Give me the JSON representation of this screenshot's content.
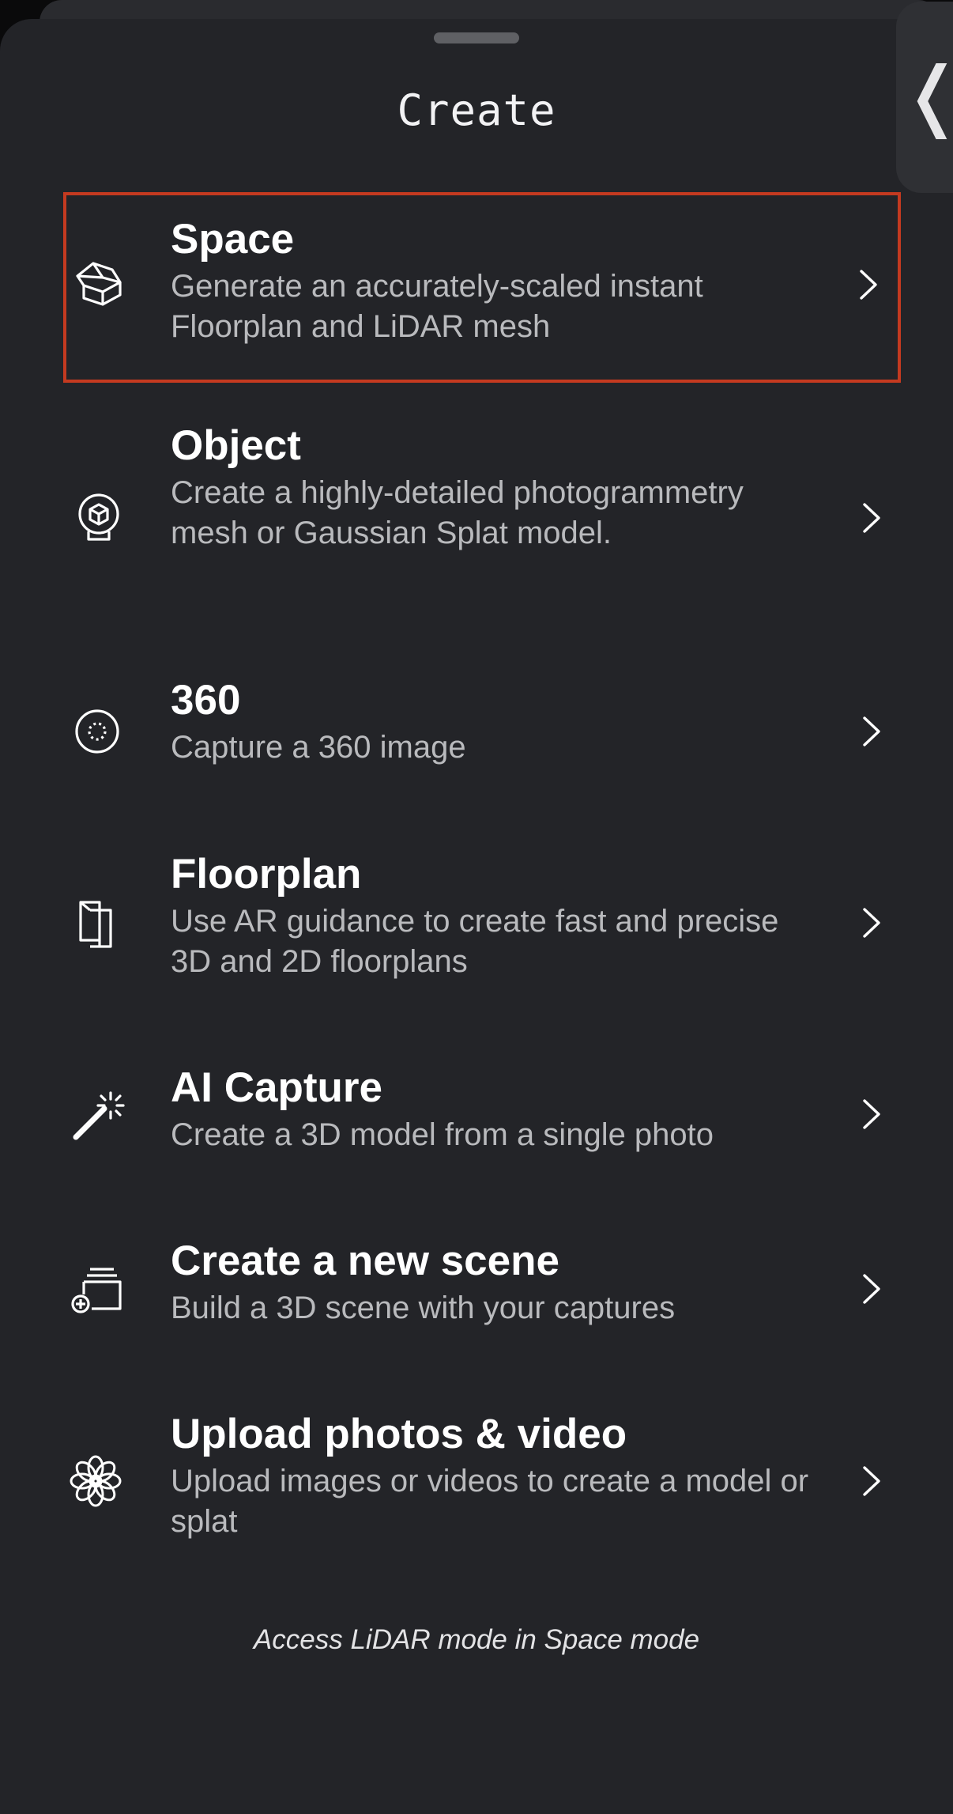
{
  "sheet": {
    "title": "Create",
    "footer_note": "Access LiDAR mode in Space mode"
  },
  "items": [
    {
      "name": "Space",
      "description": "Generate an accurately-scaled instant Floorplan and LiDAR mesh",
      "icon": "house-cube-icon",
      "highlighted": true
    },
    {
      "name": "Object",
      "description": "Create a highly-detailed photogrammetry mesh or Gaussian Splat model.",
      "icon": "object-globe-icon",
      "highlighted": false
    },
    {
      "name": "360",
      "description": "Capture a 360 image",
      "icon": "panorama-360-icon",
      "highlighted": false
    },
    {
      "name": "Floorplan",
      "description": "Use AR guidance to create fast and precise 3D and 2D floorplans",
      "icon": "floorplan-pages-icon",
      "highlighted": false
    },
    {
      "name": "AI Capture",
      "description": "Create a 3D model from a single photo",
      "icon": "magic-wand-icon",
      "highlighted": false
    },
    {
      "name": "Create a new scene",
      "description": "Build a 3D scene with your captures",
      "icon": "scene-stack-plus-icon",
      "highlighted": false
    },
    {
      "name": "Upload photos & video",
      "description": "Upload images or videos to create a model or splat",
      "icon": "photos-flower-icon",
      "highlighted": false
    }
  ],
  "colors": {
    "sheet_background": "#232428",
    "highlight_border": "#c43a20",
    "title_text": "#ffffff",
    "description_text": "#b9babd"
  }
}
